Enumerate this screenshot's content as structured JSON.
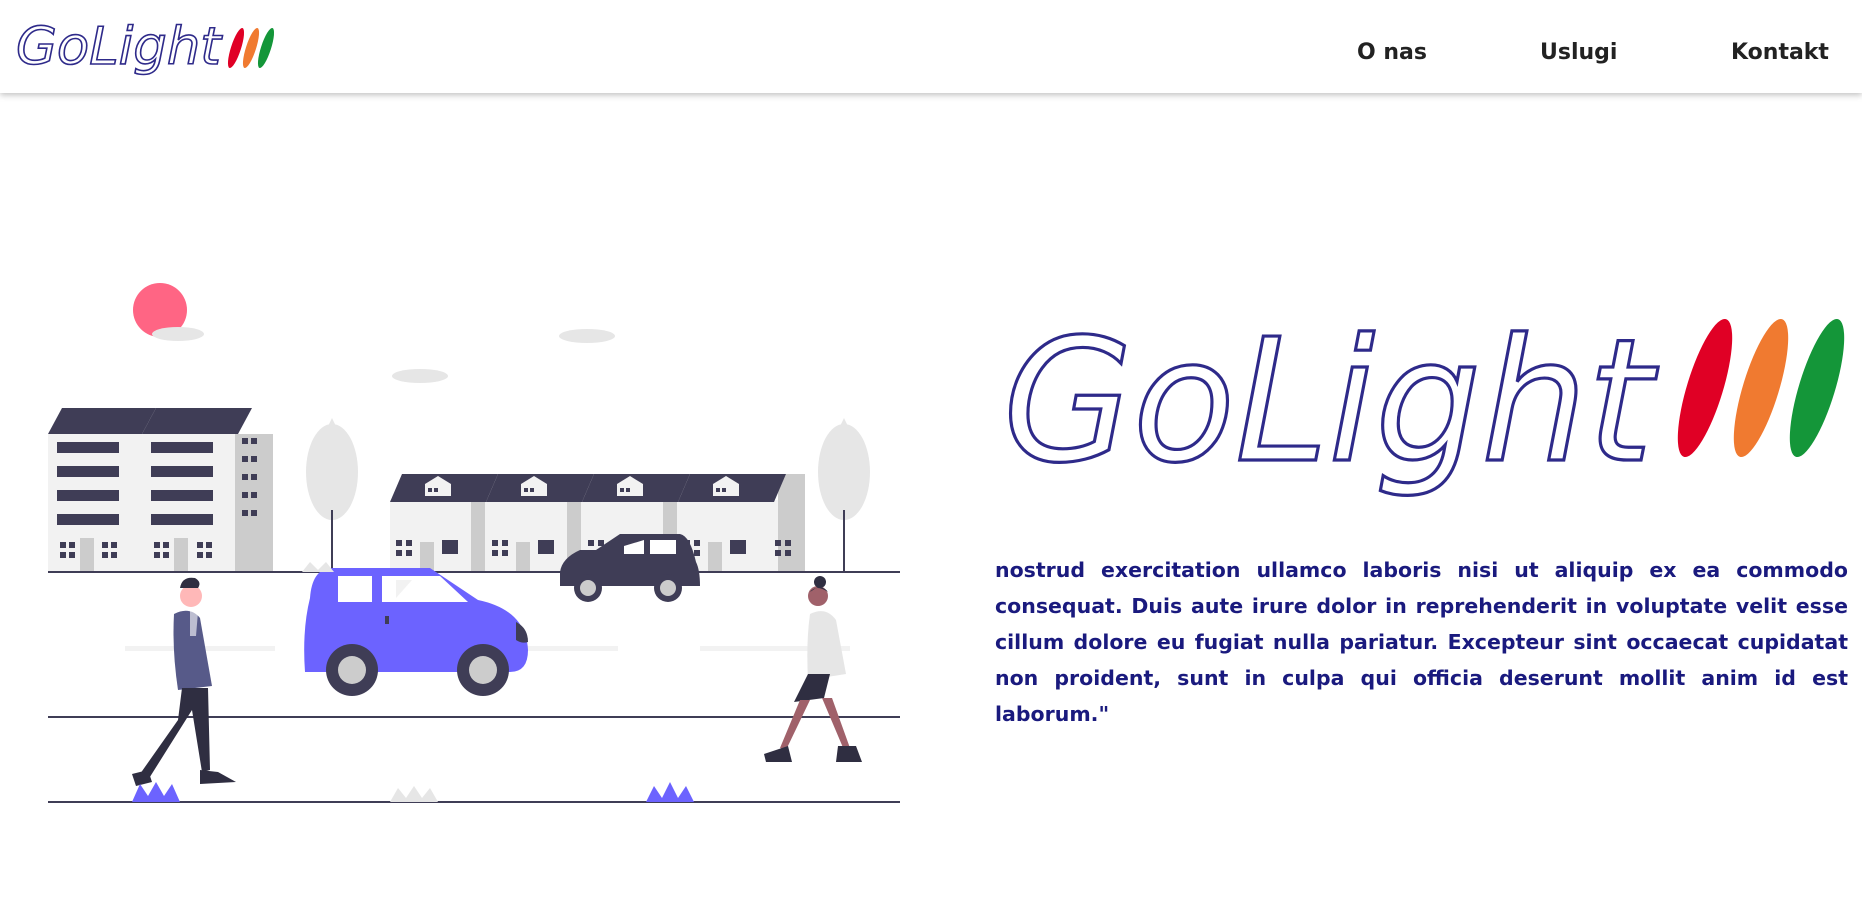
{
  "header": {
    "logo_text": "GoLight",
    "nav": [
      {
        "label": "O nas"
      },
      {
        "label": "Uslugi"
      },
      {
        "label": "Kontakt"
      }
    ]
  },
  "hero": {
    "logo_text": "GoLight",
    "paragraph": "nostrud exercitation ullamco laboris nisi ut aliquip ex ea commodo consequat. Duis aute irure dolor in reprehenderit in voluptate velit esse cillum dolore eu fugiat nulla pariatur. Excepteur sint occaecat cupidatat non proident, sunt in culpa qui officia deserunt mollit anim id est laborum.\""
  },
  "colors": {
    "brand_outline": "#2e2a8a",
    "stripe_red": "#e00025",
    "stripe_orange": "#f07a30",
    "stripe_green": "#149639",
    "accent_purple": "#6c63ff",
    "dark_slate": "#3f3d56",
    "text_navy": "#1a1a7e"
  },
  "icons": [
    "golight-logo",
    "city-street-illustration"
  ]
}
